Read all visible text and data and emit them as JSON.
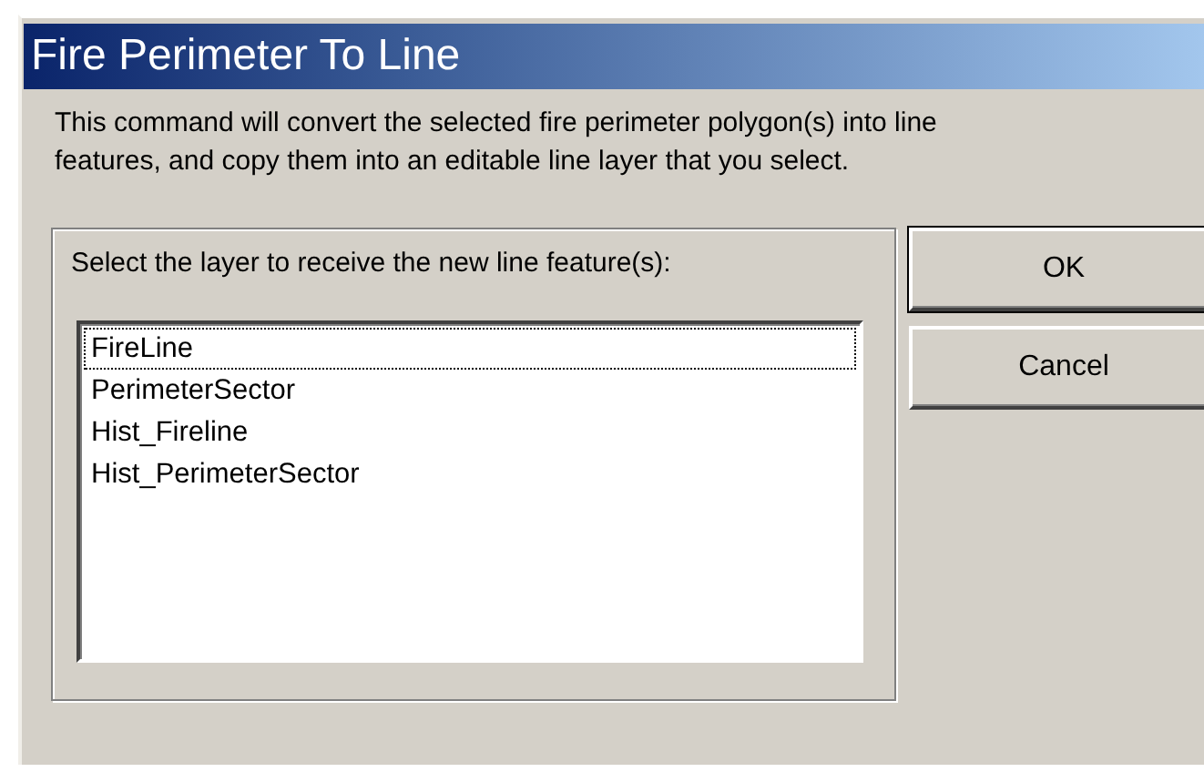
{
  "window": {
    "title": "Fire Perimeter To Line"
  },
  "description": "This command will convert the selected fire perimeter polygon(s) into line features, and copy them into an editable line layer that you select.",
  "layer_group": {
    "label": "Select the layer to receive the new line feature(s):",
    "items": [
      {
        "label": "FireLine",
        "focused": true
      },
      {
        "label": "PerimeterSector",
        "focused": false
      },
      {
        "label": "Hist_Fireline",
        "focused": false
      },
      {
        "label": "Hist_PerimeterSector",
        "focused": false
      }
    ]
  },
  "buttons": [
    {
      "label": "OK",
      "default": true
    },
    {
      "label": "Cancel",
      "default": false
    }
  ]
}
